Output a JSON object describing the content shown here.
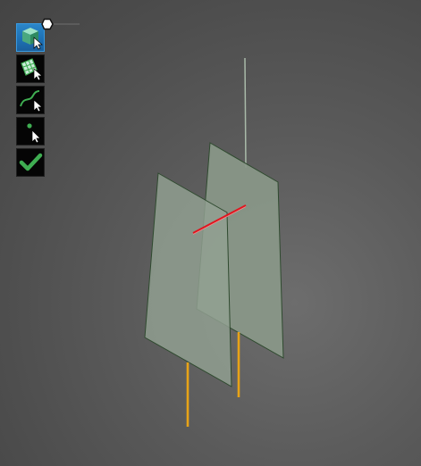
{
  "viewport": {
    "background_center": "#6d6d6d",
    "background_edge": "#444444"
  },
  "toolbar": {
    "tools": [
      {
        "id": "select-body",
        "icon": "select-body-icon",
        "active": true
      },
      {
        "id": "select-face",
        "icon": "select-face-icon",
        "active": false
      },
      {
        "id": "select-edge",
        "icon": "select-edge-icon",
        "active": false
      },
      {
        "id": "select-vertex",
        "icon": "select-vertex-icon",
        "active": false
      },
      {
        "id": "confirm",
        "icon": "checkmark-icon",
        "active": false
      }
    ],
    "accent_color": "#2b86c9",
    "icon_green": "#3fae52"
  },
  "scene": {
    "plane_fill": "#8a9889",
    "plane_edge": "#2f4a2f",
    "intersection_color": "#e0141e",
    "axis_color": "#e8a317",
    "axis_top_color": "#9fb09f"
  }
}
